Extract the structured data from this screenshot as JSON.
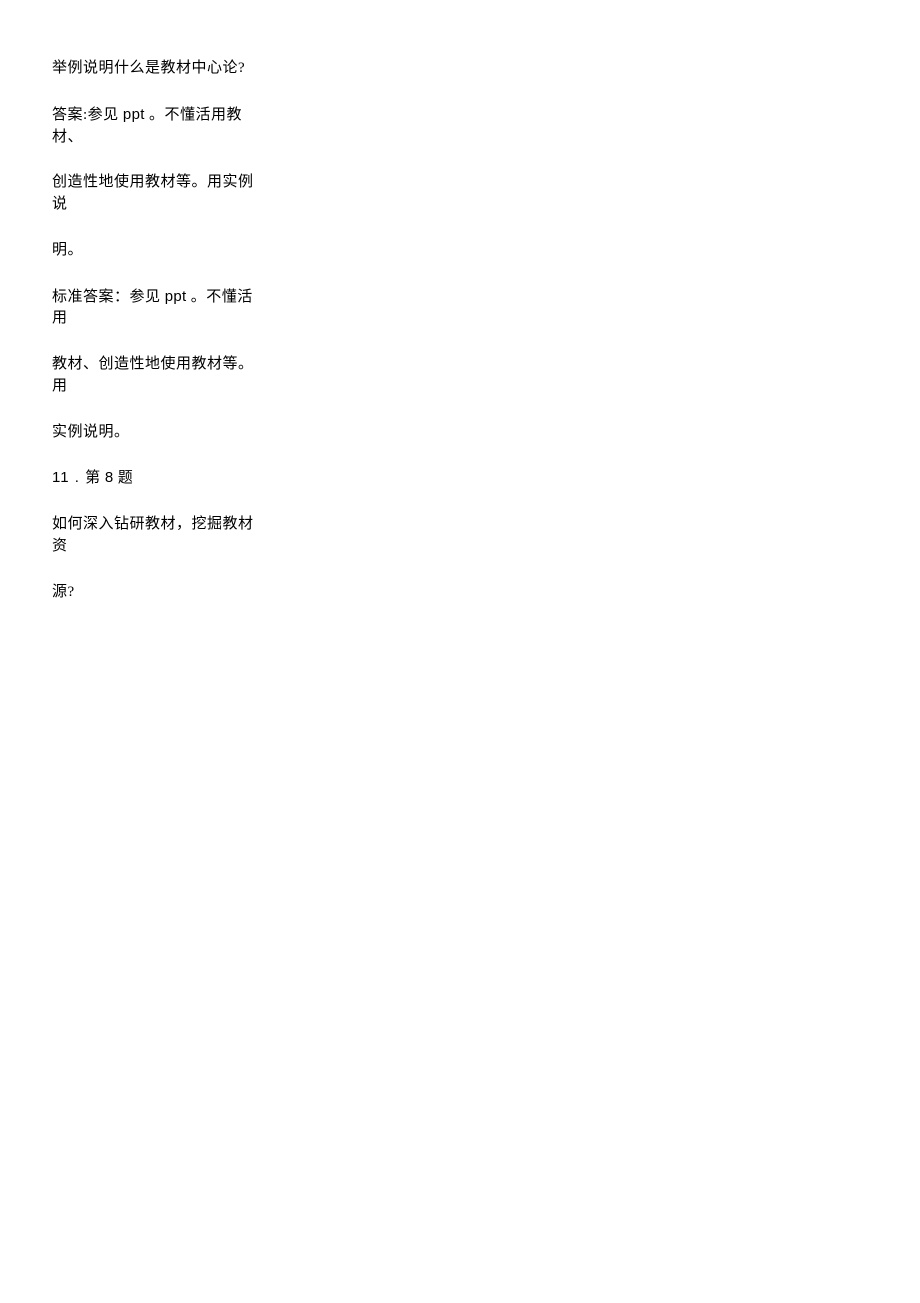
{
  "paragraphs": [
    {
      "text": "举例说明什么是教材中心论?"
    },
    {
      "prefix": "答案:参见 ",
      "latin": "ppt",
      "suffix": " 。不懂活用教材、"
    },
    {
      "text": "创造性地使用教材等。用实例说"
    },
    {
      "text": "明。"
    },
    {
      "prefix": "标准答案：参见 ",
      "latin": "ppt",
      "suffix": " 。不懂活用"
    },
    {
      "text": "教材、创造性地使用教材等。用"
    },
    {
      "text": "实例说明。"
    },
    {
      "number_prefix": "11 . ",
      "prefix": "第 ",
      "latin": "8",
      "suffix": " 题"
    },
    {
      "text": "如何深入钻研教材，挖掘教材资"
    },
    {
      "text": "源?"
    }
  ]
}
